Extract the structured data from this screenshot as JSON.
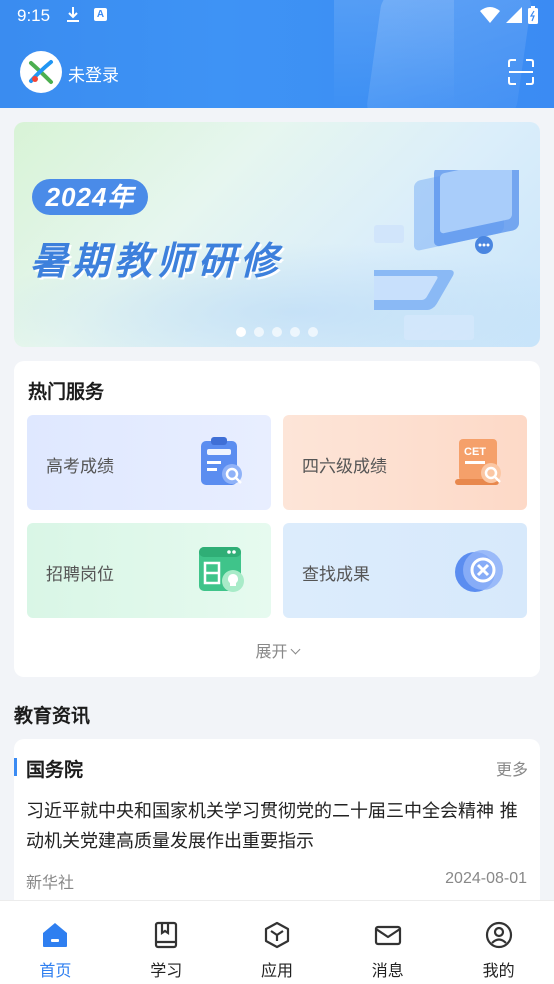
{
  "status_bar": {
    "time": "9:15"
  },
  "header": {
    "login_label": "未登录",
    "avatar_icon": "app-logo-icon",
    "scan_icon": "scan-icon"
  },
  "banner": {
    "year": "2024年",
    "title": "暑期教师研修",
    "slide_count": 5,
    "active_slide": 1
  },
  "hot_services": {
    "title": "热门服务",
    "items": [
      {
        "label": "高考成绩",
        "icon": "clipboard-search-icon"
      },
      {
        "label": "四六级成绩",
        "icon": "cet-certificate-icon"
      },
      {
        "label": "招聘岗位",
        "icon": "job-board-icon"
      },
      {
        "label": "查找成果",
        "icon": "achievement-search-icon"
      }
    ],
    "expand_label": "展开"
  },
  "education_news": {
    "section_title": "教育资讯",
    "card": {
      "source_title": "国务院",
      "more_label": "更多",
      "headline": "习近平就中央和国家机关学习贯彻党的二十届三中全会精神 推动机关党建高质量发展作出重要指示",
      "publisher": "新华社",
      "date": "2024-08-01"
    }
  },
  "tab_bar": {
    "active": 0,
    "tabs": [
      {
        "label": "首页",
        "icon": "home-icon"
      },
      {
        "label": "学习",
        "icon": "book-icon"
      },
      {
        "label": "应用",
        "icon": "cube-icon"
      },
      {
        "label": "消息",
        "icon": "mail-icon"
      },
      {
        "label": "我的",
        "icon": "user-icon"
      }
    ]
  },
  "colors": {
    "primary": "#3b8bf3",
    "background": "#f2f4f8"
  }
}
